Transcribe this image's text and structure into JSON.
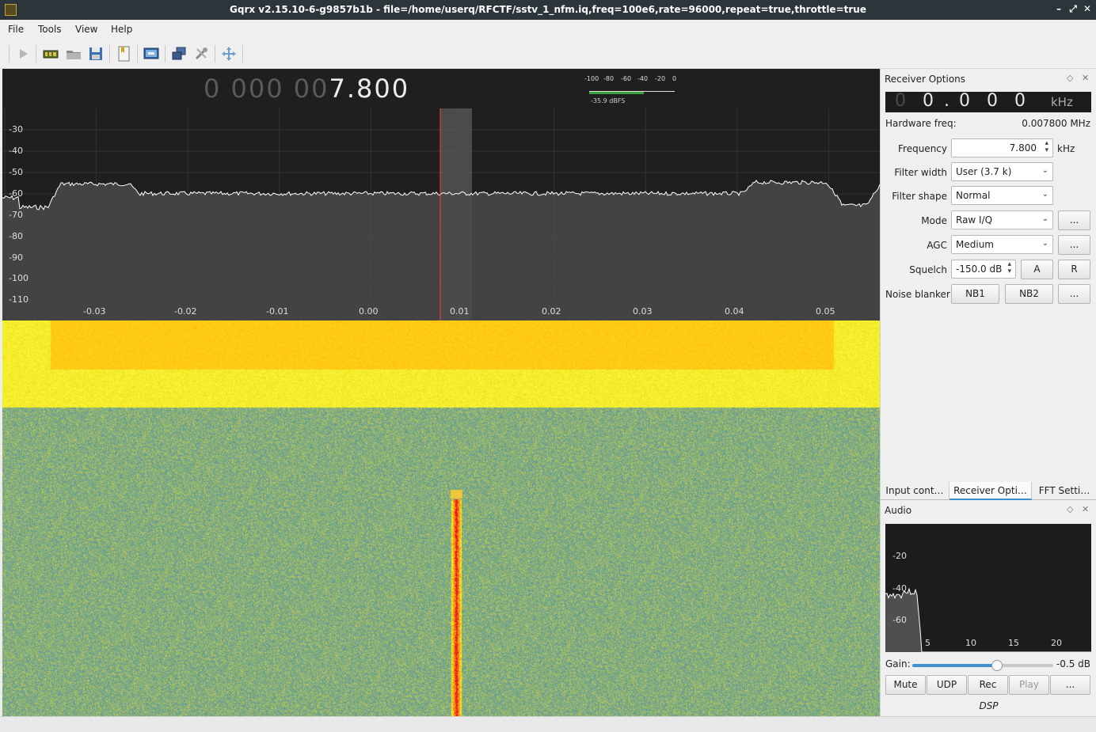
{
  "window": {
    "title": "Gqrx v2.15.10-6-g9857b1b - file=/home/userq/RFCTF/sstv_1_nfm.iq,freq=100e6,rate=96000,repeat=true,throttle=true",
    "minimize": "–",
    "restore": "⤢",
    "close": "✕"
  },
  "menu": {
    "file": "File",
    "tools": "Tools",
    "view": "View",
    "help": "Help"
  },
  "toolbar": {
    "icons": [
      "play-icon",
      "device-icon",
      "open-icon",
      "save-icon",
      "bookmark-icon",
      "screen-icon",
      "cascade-icon",
      "settings-icon",
      "move-icon"
    ]
  },
  "freq_display": {
    "dim": "0 000 00",
    "lit": "7.800"
  },
  "meter": {
    "scale": [
      "-100",
      "-80",
      "-60",
      "-40",
      "-20",
      "0"
    ],
    "value": "-35.9 dBFS",
    "level_fraction": 0.64
  },
  "spectrum": {
    "y_ticks": [
      "-30",
      "-40",
      "-50",
      "-60",
      "-70",
      "-80",
      "-90",
      "-100",
      "-110"
    ],
    "x_ticks": [
      "-0.03",
      "-0.02",
      "-0.01",
      "0.00",
      "0.01",
      "0.02",
      "0.03",
      "0.04",
      "0.05"
    ],
    "colors": {
      "trace": "#ffffff",
      "fill": "#4a4a4a",
      "marker": "#ff4040",
      "filter": "#6a6a6a",
      "background": "#1f1f1f",
      "waterfall_noise": "#6fa3b4",
      "waterfall_hot": "#ffc20a",
      "waterfall_warm": "#f2f023",
      "waterfall_signal": "#e51b1b"
    }
  },
  "receiver": {
    "title": "Receiver Options",
    "float_icon": "◇",
    "close_icon": "✕",
    "lcd": {
      "dim": "0",
      "d1": "0",
      "dot": ".",
      "d2": "0",
      "d3": "0",
      "d4": "0",
      "unit": "kHz"
    },
    "hw_label": "Hardware freq:",
    "hw_value": "0.007800 MHz",
    "frequency_label": "Frequency",
    "frequency_value": "7.800",
    "frequency_unit": "kHz",
    "filter_width_label": "Filter width",
    "filter_width_value": "User (3.7 k)",
    "filter_shape_label": "Filter shape",
    "filter_shape_value": "Normal",
    "mode_label": "Mode",
    "mode_value": "Raw I/Q",
    "mode_more": "...",
    "agc_label": "AGC",
    "agc_value": "Medium",
    "agc_more": "...",
    "squelch_label": "Squelch",
    "squelch_value": "-150.0 dB",
    "squelch_a": "A",
    "squelch_r": "R",
    "nb_label": "Noise blanker",
    "nb1": "NB1",
    "nb2": "NB2",
    "nb_more": "..."
  },
  "tabs": [
    "Input cont…",
    "Receiver Opti…",
    "FFT Setti…"
  ],
  "audio": {
    "title": "Audio",
    "float_icon": "◇",
    "close_icon": "✕",
    "y_ticks": [
      "-20",
      "-40",
      "-60"
    ],
    "x_ticks": [
      "5",
      "10",
      "15",
      "20"
    ],
    "gain_label": "Gain:",
    "gain_value": "-0.5 dB",
    "gain_fraction": 0.6,
    "mute": "Mute",
    "udp": "UDP",
    "rec": "Rec",
    "play": "Play",
    "more": "...",
    "dsp": "DSP"
  }
}
